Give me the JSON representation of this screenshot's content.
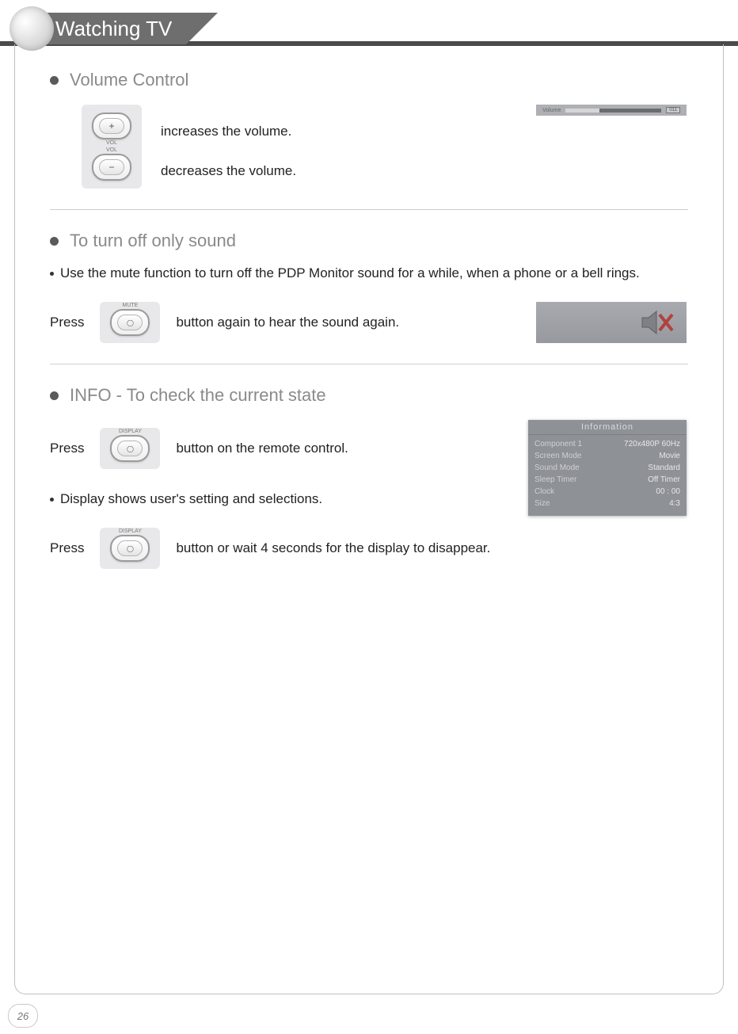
{
  "header": {
    "title": "Watching TV"
  },
  "volume": {
    "title": "Volume Control",
    "increase_text": "increases the volume.",
    "decrease_text": "decreases the volume.",
    "btn_plus_caption": "VOL",
    "btn_minus_caption": "VOL",
    "btn_plus_glyph": "+",
    "btn_minus_glyph": "−",
    "osd_label": "Volume",
    "osd_value": "011"
  },
  "mute": {
    "title": "To turn off only sound",
    "body": "Use the mute function to turn off the PDP Monitor sound for a while, when a phone or a bell rings.",
    "press_prefix": "Press",
    "press_suffix": "button again to hear the sound again.",
    "btn_label": "MUTE"
  },
  "info": {
    "title": "INFO - To check the current state",
    "press1_prefix": "Press",
    "press1_suffix": "button on the remote control.",
    "body": "Display shows user's setting and selections.",
    "press2_prefix": "Press",
    "press2_suffix": "button or wait 4 seconds for the display to disappear.",
    "btn_label": "DISPLAY",
    "osd": {
      "header": "Information",
      "rows": [
        {
          "k": "Component 1",
          "v": "720x480P 60Hz"
        },
        {
          "k": "Screen Mode",
          "v": "Movie"
        },
        {
          "k": "Sound Mode",
          "v": "Standard"
        },
        {
          "k": "Sleep Timer",
          "v": "Off Timer"
        },
        {
          "k": "Clock",
          "v": "00 : 00"
        },
        {
          "k": "Size",
          "v": "4:3"
        }
      ]
    }
  },
  "page_number": "26"
}
